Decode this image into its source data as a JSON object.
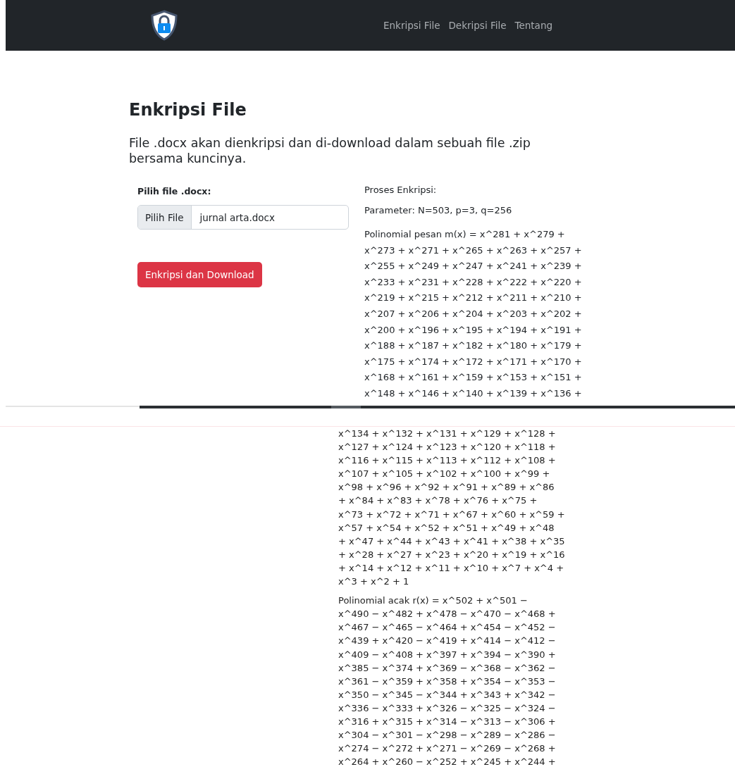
{
  "top_view": {
    "navbar": {
      "links": [
        {
          "label": "Enkripsi File"
        },
        {
          "label": "Dekripsi File"
        },
        {
          "label": "Tentang"
        }
      ]
    },
    "title": "Enkripsi File",
    "description": "File .docx akan dienkripsi dan di-download dalam sebuah file .zip bersama kuncinya.",
    "form": {
      "label": "Pilih file .docx:",
      "file_button": "Pilih File",
      "file_name": "jurnal arta.docx",
      "submit": "Enkripsi dan Download"
    },
    "process": {
      "heading": "Proses Enkripsi:",
      "parameters": "Parameter: N=503, p=3, q=256",
      "message_polynomial_lines": [
        "Polinomial pesan m(x) = x^281 + x^279 +",
        "x^273 + x^271 + x^265 + x^263 + x^257 +",
        "x^255 + x^249 + x^247 + x^241 + x^239 +",
        "x^233 + x^231 + x^228 + x^222 + x^220 +",
        "x^219 + x^215 + x^212 + x^211 + x^210 +",
        "x^207 + x^206 + x^204 + x^203 + x^202 +",
        "x^200 + x^196 + x^195 + x^194 + x^191 +",
        "x^188 + x^187 + x^182 + x^180 + x^179 +",
        "x^175 + x^174 + x^172 + x^171 + x^170 +",
        "x^168 + x^161 + x^159 + x^153 + x^151 +",
        "x^148 + x^146 + x^140 + x^139 + x^136 +"
      ]
    }
  },
  "bottom_view": {
    "message_polynomial_lines": [
      "x^134 + x^132 + x^131 + x^129 + x^128 +",
      "x^127 + x^124 + x^123 + x^120 + x^118 +",
      "x^116 + x^115 + x^113 + x^112 + x^108 +",
      "x^107 + x^105 + x^102 + x^100 + x^99 +",
      "x^98 + x^96 + x^92 + x^91 + x^89 + x^86",
      "+ x^84 + x^83 + x^78 + x^76 + x^75 +",
      "x^73 + x^72 + x^71 + x^67 + x^60 + x^59 +",
      "x^57 + x^54 + x^52 + x^51 + x^49 + x^48",
      "+ x^47 + x^44 + x^43 + x^41 + x^38 + x^35",
      "+ x^28 + x^27 + x^23 + x^20 + x^19 + x^16",
      "+ x^14 + x^12 + x^11 + x^10 + x^7 + x^4 +",
      "x^3 + x^2 + 1"
    ],
    "random_polynomial_lines": [
      "Polinomial acak r(x) = x^502 + x^501 −",
      "x^490 − x^482 + x^478 − x^470 − x^468 +",
      "x^467 − x^465 − x^464 + x^454 − x^452 −",
      "x^439 + x^420 − x^419 + x^414 − x^412 −",
      "x^409 − x^408 + x^397 + x^394 − x^390 +",
      "x^385 − x^374 + x^369 − x^368 − x^362 −",
      "x^361 − x^359 + x^358 + x^354 − x^353 −",
      "x^350 − x^345 − x^344 + x^343 + x^342 −",
      "x^336 − x^333 + x^326 − x^325 − x^324 −",
      "x^316 + x^315 + x^314 − x^313 − x^306 +",
      "x^304 − x^301 − x^298 − x^289 − x^286 −",
      "x^274 − x^272 + x^271 − x^269 − x^268 +",
      "x^264 + x^260 − x^252 + x^245 + x^244 +"
    ]
  }
}
